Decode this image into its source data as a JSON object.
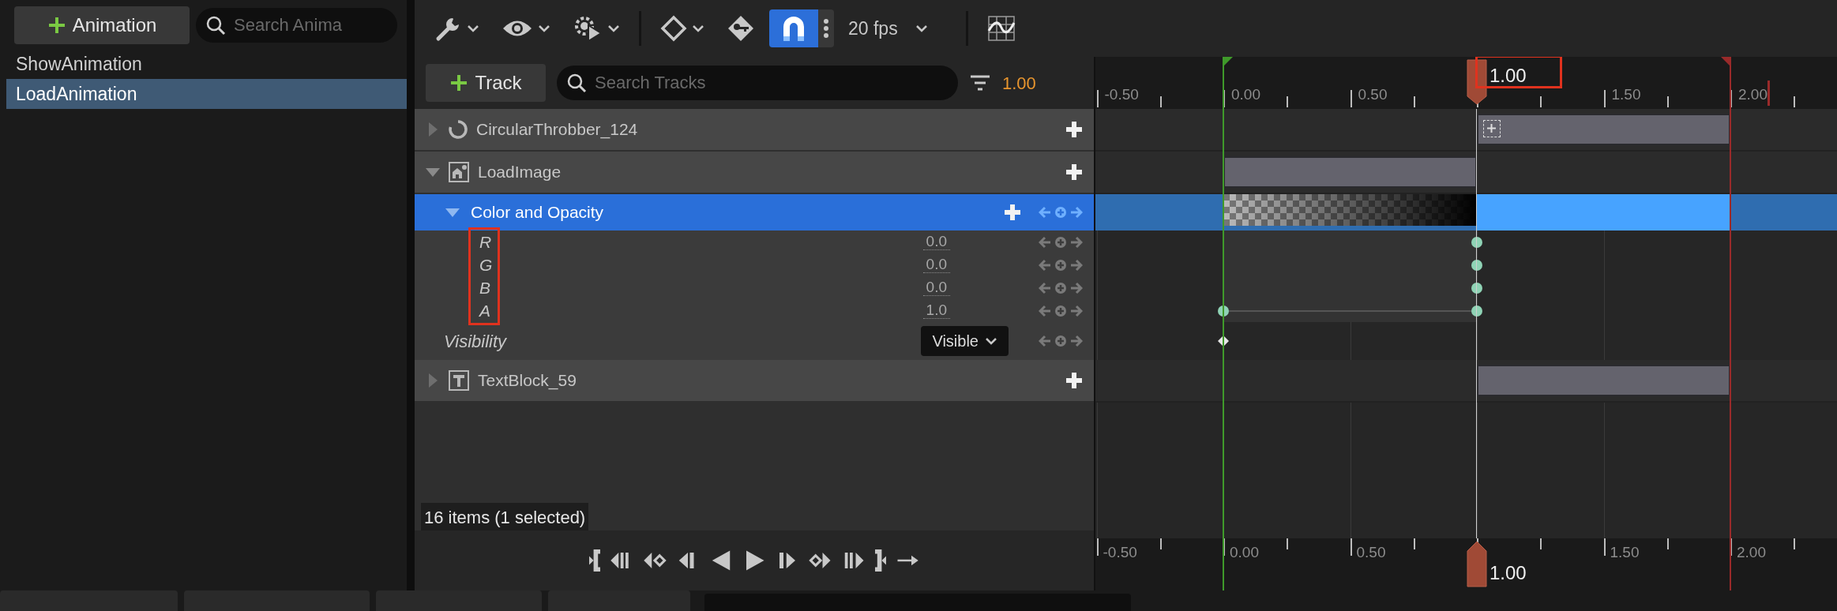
{
  "sidebar": {
    "add_button": {
      "label": "Animation"
    },
    "search": {
      "placeholder": "Search Anima"
    },
    "items": [
      {
        "label": "ShowAnimation",
        "selected": false
      },
      {
        "label": "LoadAnimation",
        "selected": true
      }
    ]
  },
  "toolbar": {
    "snap": {
      "on": true
    },
    "frame_rate": "20 fps"
  },
  "track_bar": {
    "add_button": {
      "label": "Track"
    },
    "search": {
      "placeholder": "Search Tracks"
    },
    "current_time": "1.00"
  },
  "tracks": [
    {
      "kind": "throbber",
      "label": "CircularThrobber_124",
      "expanded": false,
      "selected": false,
      "section_before_playhead": false
    },
    {
      "kind": "image",
      "label": "LoadImage",
      "expanded": true,
      "selected": false,
      "section_before_playhead": true,
      "children": [
        {
          "kind": "color",
          "label": "Color and Opacity",
          "expanded": true,
          "selected": true,
          "channels_highlighted": true,
          "section_before_playhead": true,
          "children": [
            {
              "kind": "channel",
              "label": "R",
              "value": "0.0",
              "selected": false,
              "key_at_start": false,
              "key_at_playhead": true
            },
            {
              "kind": "channel",
              "label": "G",
              "value": "0.0",
              "selected": false,
              "key_at_start": false,
              "key_at_playhead": true
            },
            {
              "kind": "channel",
              "label": "B",
              "value": "0.0",
              "selected": false,
              "key_at_start": false,
              "key_at_playhead": true
            },
            {
              "kind": "channel",
              "label": "A",
              "value": "1.0",
              "selected": false,
              "key_at_start": true,
              "key_at_playhead": true
            }
          ]
        },
        {
          "kind": "enum",
          "label": "Visibility",
          "value": "Visible",
          "selected": false,
          "key_at_start": true,
          "key_at_playhead": false
        }
      ]
    },
    {
      "kind": "text",
      "label": "TextBlock_59",
      "expanded": false,
      "selected": false,
      "section_before_playhead": false
    }
  ],
  "status": "16 items (1 selected)",
  "timeline": {
    "top_ruler": {
      "labels": [
        {
          "label": "-0.50",
          "range_start": false,
          "range_end": false
        },
        {
          "label": "0.00",
          "range_start": true,
          "range_end": false
        },
        {
          "label": "0.50",
          "range_start": false,
          "range_end": false
        },
        {
          "label": "1.50",
          "range_start": false,
          "range_end": false
        },
        {
          "label": "2.00",
          "range_start": false,
          "range_end": true
        }
      ],
      "playhead": "1.00",
      "playhead_highlighted": true
    },
    "bottom_ruler": {
      "labels": [
        "-0.50",
        "0.00",
        "0.50",
        "1.50",
        "2.00"
      ],
      "playhead": "1.00"
    }
  }
}
